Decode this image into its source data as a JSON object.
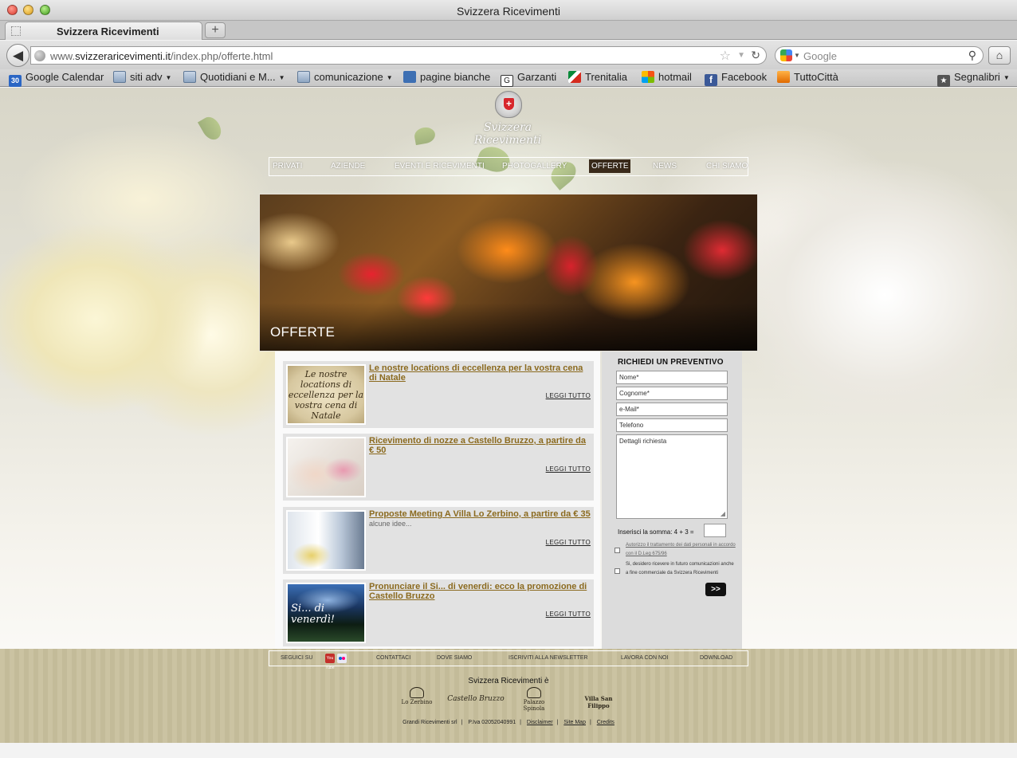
{
  "window": {
    "title": "Svizzera Ricevimenti"
  },
  "tabs": [
    {
      "label": "Svizzera Ricevimenti"
    }
  ],
  "toolbar": {
    "url_prefix": "www.",
    "url_host": "svizzeraricevimenti.it",
    "url_path": "/index.php/offerte.html",
    "search_placeholder": "Google"
  },
  "bookmarks": [
    {
      "label": "Google Calendar",
      "icon": "calendar-icon",
      "badge": "30"
    },
    {
      "label": "siti adv",
      "icon": "folder-icon"
    },
    {
      "label": "Quotidiani e M...",
      "icon": "folder-icon"
    },
    {
      "label": "comunicazione",
      "icon": "folder-icon"
    },
    {
      "label": "pagine bianche",
      "icon": "pagine-bianche-icon"
    },
    {
      "label": "Garzanti",
      "icon": "garzanti-icon",
      "badge": "G"
    },
    {
      "label": "Trenitalia",
      "icon": "trenitalia-icon"
    },
    {
      "label": "hotmail",
      "icon": "hotmail-icon"
    },
    {
      "label": "Facebook",
      "icon": "facebook-icon",
      "badge": "f"
    },
    {
      "label": "TuttoCittà",
      "icon": "tuttocitta-icon"
    },
    {
      "label": "Segnalibri",
      "icon": "bookmarks-star-icon",
      "badge": "★"
    }
  ],
  "site": {
    "logo_text": "Svizzera Ricevimenti",
    "nav": [
      "PRIVATI",
      "AZIENDE",
      "EVENTI E RICEVIMENTI",
      "PHOTOGALLERY",
      "OFFERTE",
      "NEWS",
      "CHI SIAMO"
    ],
    "active_nav": "OFFERTE",
    "hero_title": "OFFERTE",
    "read_more": "LEGGI TUTTO",
    "offers": [
      {
        "title": "Le nostre locations di eccellenza per la vostra cena di Natale",
        "thumb_text": "Le nostre locations di eccellenza per la vostra cena di Natale",
        "summary": ""
      },
      {
        "title": "Ricevimento di nozze a Castello Bruzzo, a partire da € 50",
        "thumb_text": "",
        "summary": ""
      },
      {
        "title": "Proposte Meeting A Villa Lo Zerbino, a partire da € 35",
        "thumb_text": "",
        "summary": "alcune idee..."
      },
      {
        "title": "Pronunciare il Si... di venerdi: ecco la promozione di Castello Bruzzo",
        "thumb_text": "Si... di venerdì!",
        "summary": ""
      }
    ],
    "form": {
      "title": "RICHIEDI UN PREVENTIVO",
      "fields": [
        "Nome*",
        "Cognome*",
        "e-Mail*",
        "Telefono"
      ],
      "details_placeholder": "Dettagli richiesta",
      "captcha_label": "Inserisci la somma: 4 + 3 =",
      "privacy_label": "Autorizzo il trattamento dei dati personali in accordo con il D.Leg 675/96",
      "newsletter_label": "Si, desidero ricevere in futuro comunicazioni anche a fine commerciale da Svizzera Ricevimenti",
      "submit_label": ">>"
    },
    "footer": {
      "follow_label": "SEGUICI SU",
      "youtube_badge": "You Tube",
      "links": [
        "CONTATTACI",
        "DOVE SIAMO",
        "ISCRIVITI ALLA NEWSLETTER",
        "LAVORA CON NOI",
        "DOWNLOAD"
      ],
      "brand_heading": "Svizzera Ricevimenti è",
      "brands": [
        "Lo Zerbino",
        "Castello Bruzzo",
        "Palazzo Spinola",
        "Villa San Filippo"
      ],
      "company": "Grandi Ricevimenti srl",
      "vat": "P.Iva 02052040991",
      "legal_links": [
        "Disclaimer",
        "Site Map",
        "Credits"
      ]
    }
  }
}
